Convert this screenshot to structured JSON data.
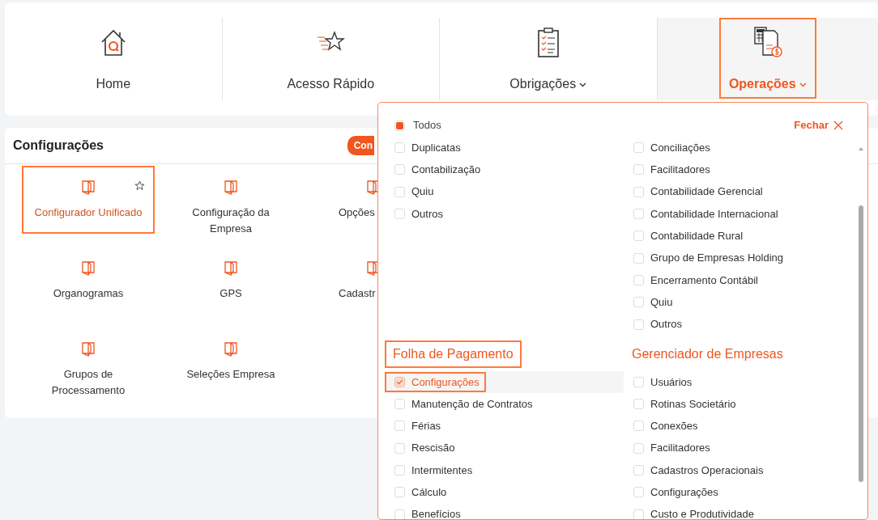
{
  "nav": {
    "tabs": [
      {
        "label": "Home",
        "dropdown": false,
        "selected": false,
        "highlighted": false
      },
      {
        "label": "Acesso Rápido",
        "dropdown": false,
        "selected": false,
        "highlighted": false
      },
      {
        "label": "Obrigações",
        "dropdown": true,
        "selected": false,
        "highlighted": false
      },
      {
        "label": "Operações",
        "dropdown": true,
        "selected": true,
        "highlighted": true
      }
    ]
  },
  "panel": {
    "title": "Configurações",
    "badge": "Con",
    "items": [
      {
        "label": "Configurador Unificado",
        "favorite": true,
        "highlighted": true
      },
      {
        "label": "Configuração da Empresa",
        "favorite": false,
        "highlighted": false
      },
      {
        "label": "Opções",
        "favorite": false,
        "highlighted": false
      },
      {
        "label": "Organogramas",
        "favorite": false,
        "highlighted": false
      },
      {
        "label": "GPS",
        "favorite": false,
        "highlighted": false
      },
      {
        "label": "Cadastr",
        "favorite": false,
        "highlighted": false
      },
      {
        "label": "Grupos de Processamento",
        "favorite": false,
        "highlighted": false
      },
      {
        "label": "Seleções Empresa",
        "favorite": false,
        "highlighted": false
      }
    ]
  },
  "dropdown": {
    "all_option": {
      "label": "Todos",
      "selected": true
    },
    "close": "Fechar",
    "blocks": [
      {
        "left": {
          "items": [
            {
              "label": "Duplicatas",
              "checked": false,
              "highlighted": false
            },
            {
              "label": "Contabilização",
              "checked": false,
              "highlighted": false
            },
            {
              "label": "Quiu",
              "checked": false,
              "highlighted": false
            },
            {
              "label": "Outros",
              "checked": false,
              "highlighted": false
            }
          ]
        },
        "right": {
          "items": [
            {
              "label": "Conciliações",
              "checked": false,
              "highlighted": false
            },
            {
              "label": "Facilitadores",
              "checked": false,
              "highlighted": false
            },
            {
              "label": "Contabilidade Gerencial",
              "checked": false,
              "highlighted": false
            },
            {
              "label": "Contabilidade Internacional",
              "checked": false,
              "highlighted": false
            },
            {
              "label": "Contabilidade Rural",
              "checked": false,
              "highlighted": false
            },
            {
              "label": "Grupo de Empresas Holding",
              "checked": false,
              "highlighted": false
            },
            {
              "label": "Encerramento Contábil",
              "checked": false,
              "highlighted": false
            },
            {
              "label": "Quiu",
              "checked": false,
              "highlighted": false
            },
            {
              "label": "Outros",
              "checked": false,
              "highlighted": false
            }
          ]
        }
      },
      {
        "left": {
          "title": "Folha de Pagamento",
          "highlighted": true,
          "items": [
            {
              "label": "Configurações",
              "checked": true,
              "highlighted": true
            },
            {
              "label": "Manutenção de Contratos",
              "checked": false,
              "highlighted": false
            },
            {
              "label": "Férias",
              "checked": false,
              "highlighted": false
            },
            {
              "label": "Rescisão",
              "checked": false,
              "highlighted": false
            },
            {
              "label": "Intermitentes",
              "checked": false,
              "highlighted": false
            },
            {
              "label": "Cálculo",
              "checked": false,
              "highlighted": false
            },
            {
              "label": "Benefícios",
              "checked": false,
              "highlighted": false
            }
          ]
        },
        "right": {
          "title": "Gerenciador de Empresas",
          "highlighted": false,
          "items": [
            {
              "label": "Usuários",
              "checked": false,
              "highlighted": false
            },
            {
              "label": "Rotinas Societário",
              "checked": false,
              "highlighted": false
            },
            {
              "label": "Conexões",
              "checked": false,
              "highlighted": false
            },
            {
              "label": "Facilitadores",
              "checked": false,
              "highlighted": false
            },
            {
              "label": "Cadastros Operacionais",
              "checked": false,
              "highlighted": false
            },
            {
              "label": "Configurações",
              "checked": false,
              "highlighted": false
            },
            {
              "label": "Custo e Produtividade",
              "checked": false,
              "highlighted": false
            }
          ]
        }
      }
    ]
  }
}
